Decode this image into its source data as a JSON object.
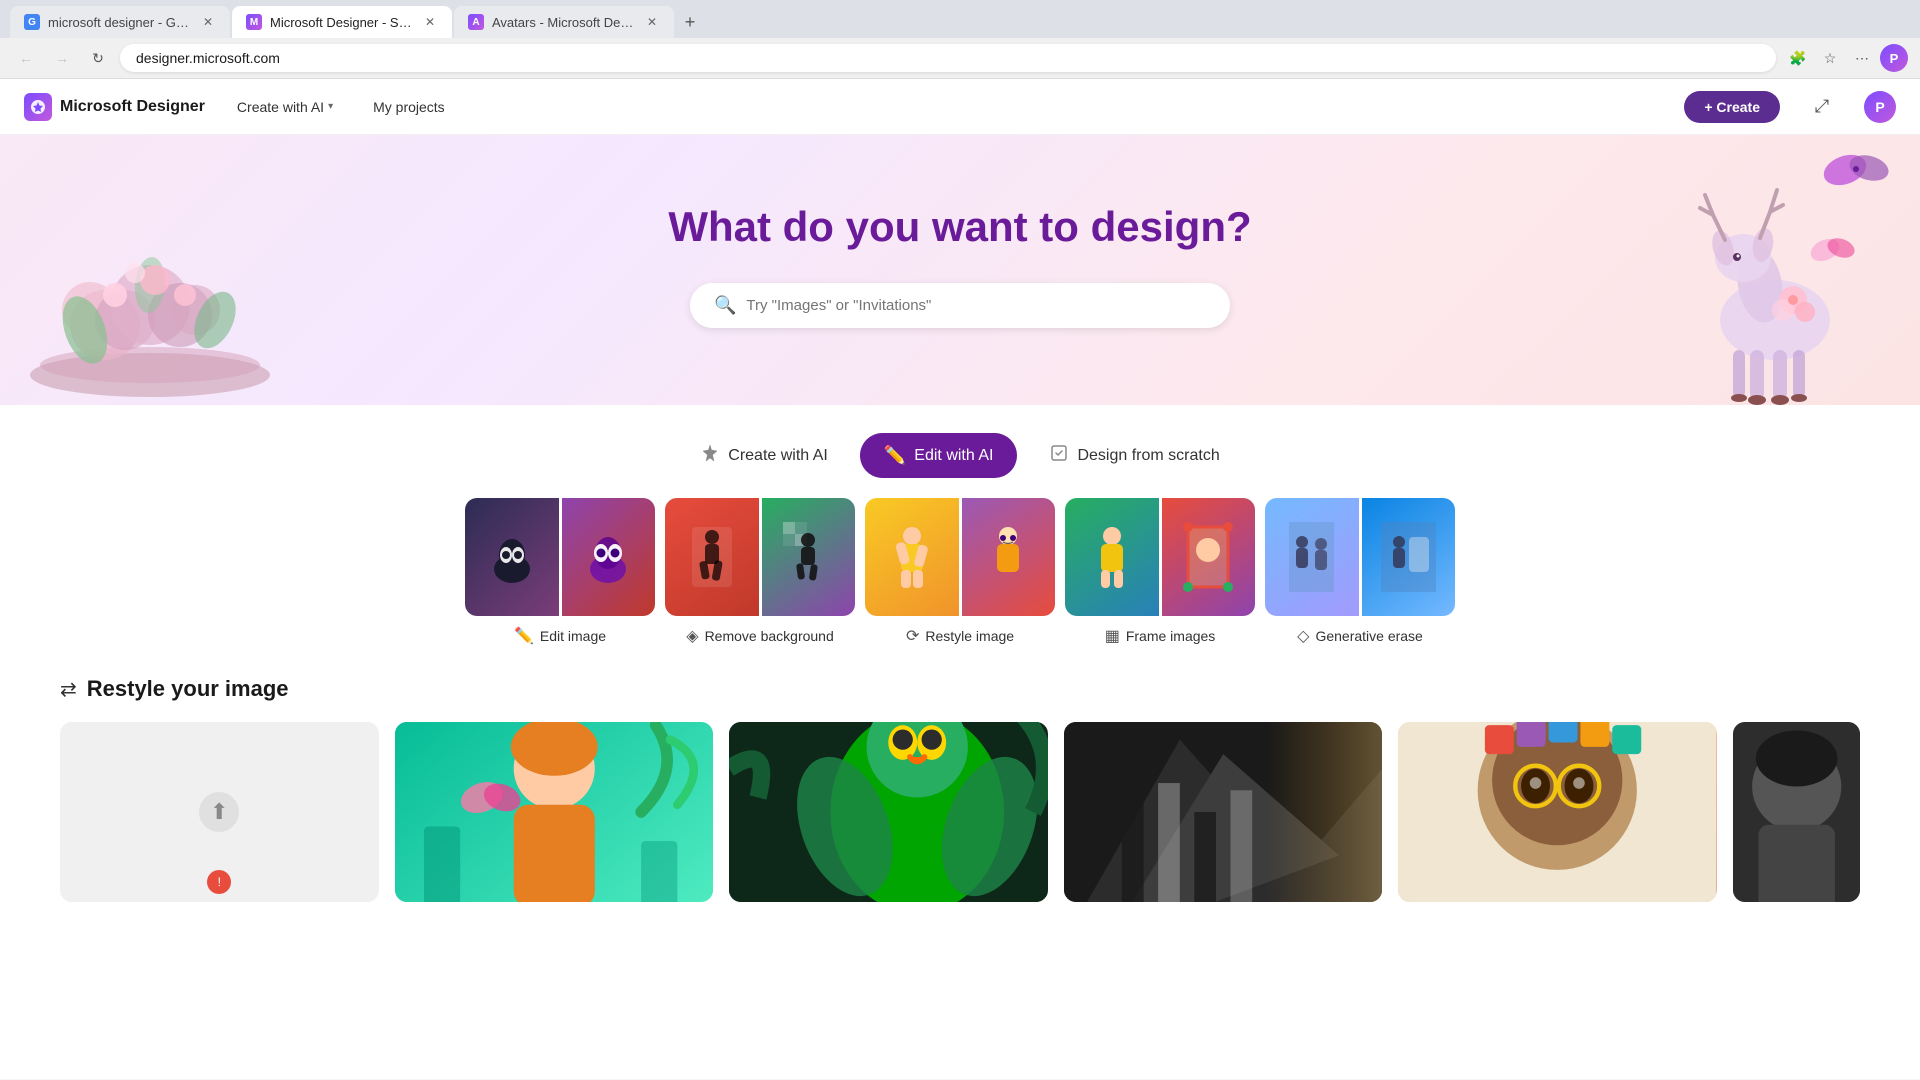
{
  "browser": {
    "tabs": [
      {
        "id": "tab1",
        "title": "microsoft designer - Google S...",
        "active": false,
        "favicon": "G"
      },
      {
        "id": "tab2",
        "title": "Microsoft Designer - Stunning...",
        "active": true,
        "favicon": "M"
      },
      {
        "id": "tab3",
        "title": "Avatars - Microsoft Designer",
        "active": false,
        "favicon": "A"
      }
    ],
    "new_tab_label": "+",
    "address": "designer.microsoft.com",
    "nav_back": "←",
    "nav_forward": "→",
    "nav_refresh": "↻"
  },
  "navbar": {
    "brand_name": "Microsoft Designer",
    "brand_icon": "✦",
    "create_with_ai_label": "Create with AI",
    "my_projects_label": "My projects",
    "create_button_label": "+ Create",
    "share_icon": "⤢",
    "profile_icon": "👤"
  },
  "hero": {
    "title": "What do you want to design?",
    "search_placeholder": "Try \"Images\" or \"Invitations\""
  },
  "tabs": [
    {
      "id": "create-with-ai",
      "label": "Create with AI",
      "icon": "✦",
      "active": false
    },
    {
      "id": "edit-with-ai",
      "label": "Edit with AI",
      "icon": "✏️",
      "active": true
    },
    {
      "id": "design-from-scratch",
      "label": "Design from scratch",
      "icon": "🖊",
      "active": false
    }
  ],
  "gallery": {
    "items": [
      {
        "id": "edit-image",
        "label": "Edit image",
        "icon": "🖊",
        "colors": [
          "#3a3a6a",
          "#9b59b6"
        ]
      },
      {
        "id": "remove-background",
        "label": "Remove background",
        "icon": "◈",
        "colors": [
          "#c0392b",
          "#f39c12"
        ]
      },
      {
        "id": "restyle-image",
        "label": "Restyle image",
        "icon": "⟳",
        "colors": [
          "#f9ca24",
          "#e55039"
        ]
      },
      {
        "id": "frame-images",
        "label": "Frame images",
        "icon": "▦",
        "colors": [
          "#27ae60",
          "#2980b9"
        ]
      },
      {
        "id": "generative-erase",
        "label": "Generative erase",
        "icon": "◇",
        "colors": [
          "#74b9ff",
          "#a29bfe"
        ]
      }
    ]
  },
  "restyle_section": {
    "title": "Restyle your image",
    "icon": "⟳",
    "items": [
      {
        "id": "restyle1",
        "bg": "#00b894",
        "label": ""
      },
      {
        "id": "restyle2",
        "bg": "#2d3436",
        "label": ""
      },
      {
        "id": "restyle3",
        "bg": "#6c5ce7",
        "label": ""
      },
      {
        "id": "restyle4",
        "bg": "#fdcb6e",
        "label": ""
      },
      {
        "id": "restyle5",
        "bg": "#636e72",
        "label": ""
      }
    ]
  }
}
